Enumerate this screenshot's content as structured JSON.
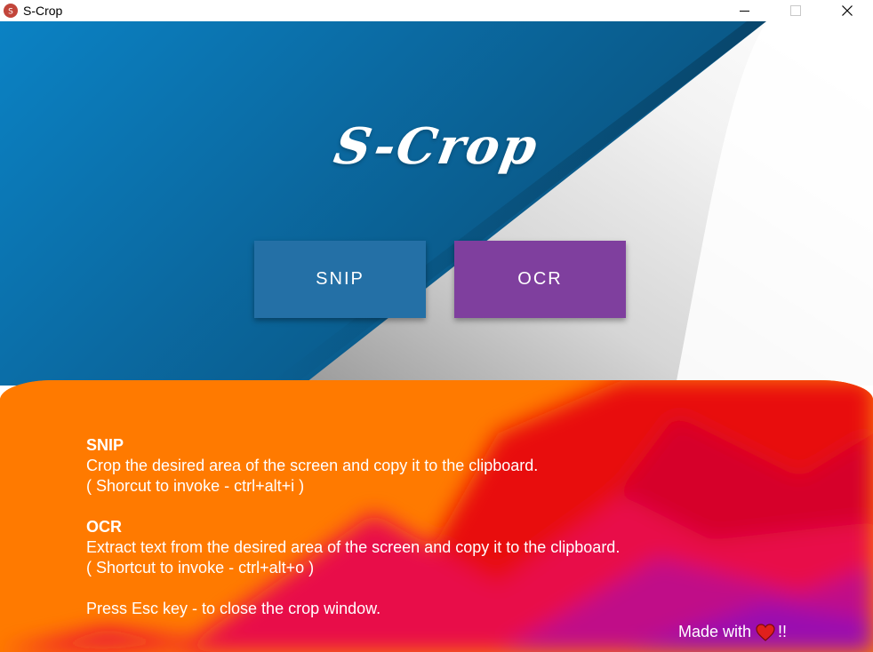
{
  "window": {
    "title": "S-Crop",
    "app_icon": "s-crop-app-icon",
    "controls": [
      "minimize-icon",
      "maximize-icon",
      "close-icon"
    ]
  },
  "colors": {
    "snip_button": "#2470a6",
    "ocr_button": "#7f3f9e",
    "top_panel": "#0b6aa2",
    "bottom_panel": "#ff7a00",
    "heart": "#e0201c"
  },
  "header": {
    "logo_text": "S-Crop"
  },
  "buttons": {
    "snip_label": "SNIP",
    "ocr_label": "OCR"
  },
  "info": {
    "snip_heading": "SNIP",
    "snip_desc": "Crop the desired area of the screen and copy it to the clipboard.",
    "snip_shortcut": "( Shorcut to invoke - ctrl+alt+i )",
    "ocr_heading": "OCR",
    "ocr_desc": "Extract text from the desired area of the screen and copy it to the clipboard.",
    "ocr_shortcut": "( Shortcut to invoke - ctrl+alt+o )",
    "esc_note": "Press Esc key - to close the crop window."
  },
  "footer": {
    "made_with": "Made with",
    "heart_icon": "heart-icon",
    "suffix": "!!"
  }
}
